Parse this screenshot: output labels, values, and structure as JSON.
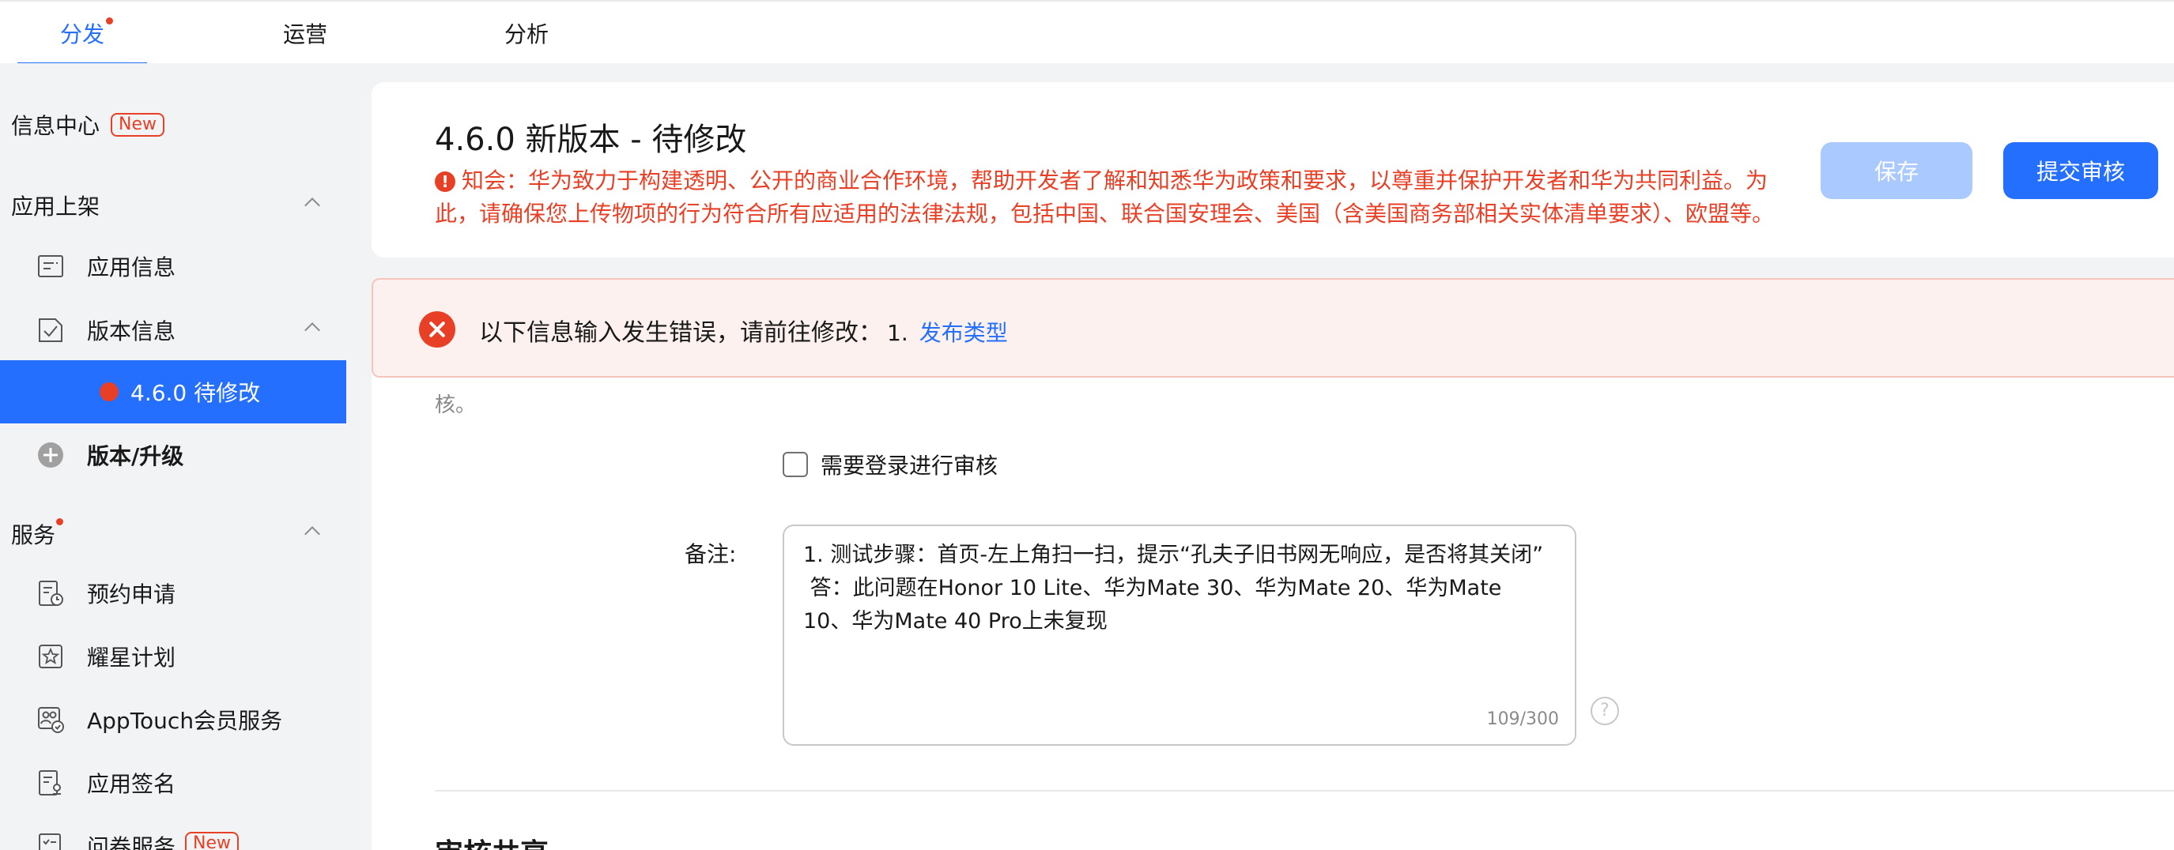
{
  "top_tabs": [
    {
      "label": "分发",
      "active": true,
      "has_dot": true
    },
    {
      "label": "运营",
      "active": false,
      "has_dot": false
    },
    {
      "label": "分析",
      "active": false,
      "has_dot": false
    }
  ],
  "sidebar": {
    "info_center": {
      "label": "信息中心",
      "badge": "New"
    },
    "section_app_listing": {
      "label": "应用上架"
    },
    "items_listing": [
      {
        "label": "应用信息",
        "icon": "document-icon"
      },
      {
        "label": "版本信息",
        "icon": "version-check-icon"
      },
      {
        "label": "4.6.0 待修改",
        "icon": "red-status-dot"
      },
      {
        "label": "版本/升级",
        "icon": "plus-circle-icon"
      }
    ],
    "section_services": {
      "label": "服务"
    },
    "items_services": [
      {
        "label": "预约申请",
        "icon": "appointment-icon"
      },
      {
        "label": "耀星计划",
        "icon": "star-badge-icon"
      },
      {
        "label": "AppTouch会员服务",
        "icon": "members-icon"
      },
      {
        "label": "应用签名",
        "icon": "signature-icon"
      },
      {
        "label": "问卷服务",
        "icon": "survey-icon",
        "badge": "New"
      }
    ]
  },
  "header": {
    "title": "4.6.0 新版本 - 待修改",
    "notice": "知会：华为致力于构建透明、公开的商业合作环境，帮助开发者了解和知悉华为政策和要求，以尊重并保护开发者和华为共同利益。为此，请确保您上传物项的行为符合所有应适用的法律法规，包括中国、联合国安理会、美国（含美国商务部相关实体清单要求）、欧盟等。",
    "save_label": "保存",
    "submit_label": "提交审核"
  },
  "error_banner": {
    "message": "以下信息输入发生错误，请前往修改：",
    "item_number": "1.",
    "link_label": "发布类型"
  },
  "form": {
    "cut_text": "核。",
    "login_review_label": "需要登录进行审核",
    "remark_label": "备注:",
    "remark_value": "1. 测试步骤：首页-左上角扫一扫，提示“孔夫子旧书网无响应，是否将其关闭”\n 答：此问题在Honor 10 Lite、华为Mate 30、华为Mate 20、华为Mate 10、华为Mate 40 Pro上未复现",
    "remark_counter": "109/300",
    "next_heading": "审核共享"
  },
  "colors": {
    "accent": "#256fff",
    "error": "#e84026",
    "disabled_button": "#a9c9ff"
  }
}
